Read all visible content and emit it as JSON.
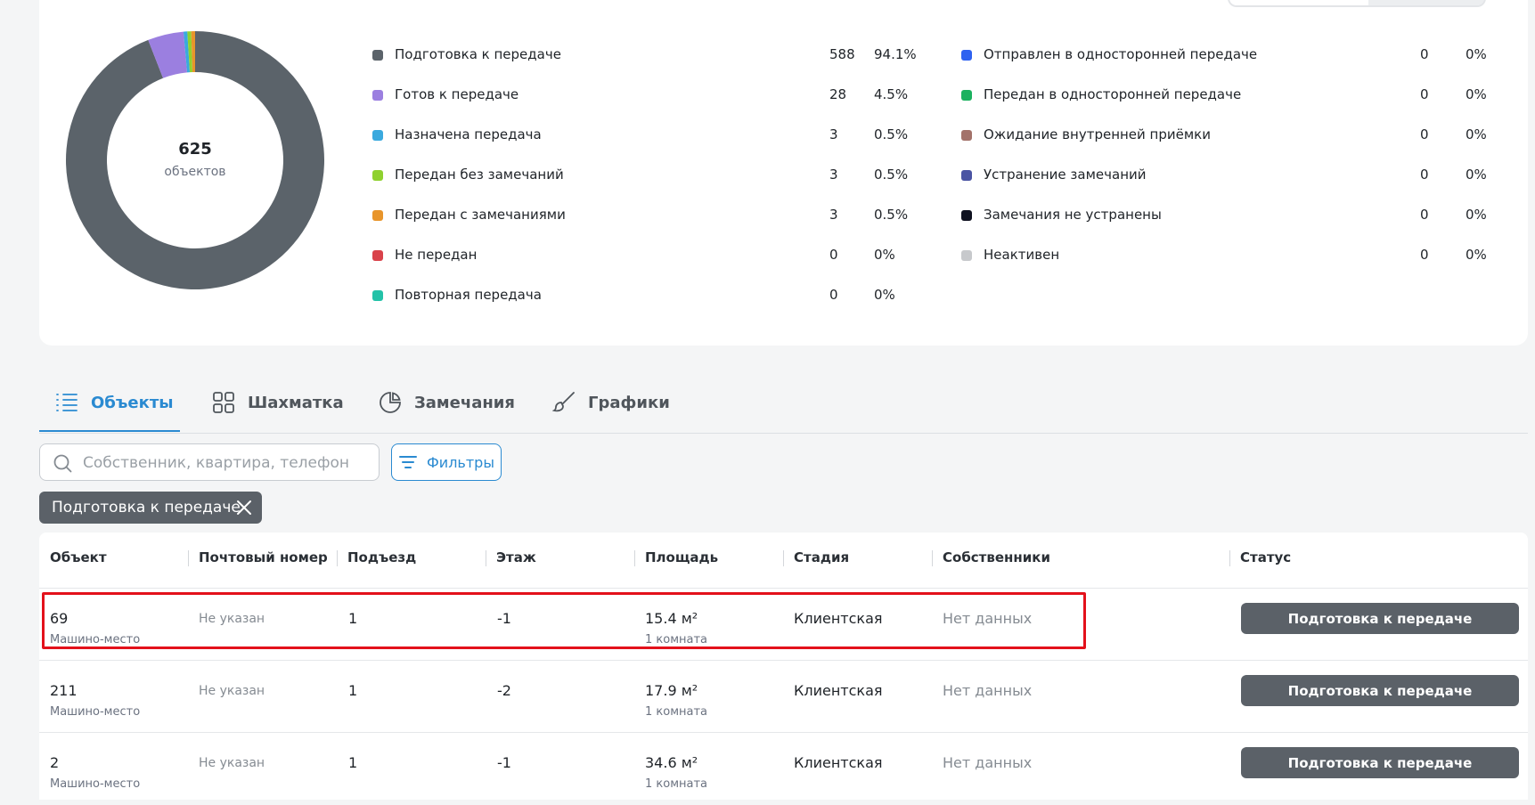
{
  "donut": {
    "count": "625",
    "unit": "объектов",
    "segments": [
      {
        "value": 588,
        "color": "#5b636a"
      },
      {
        "value": 28,
        "color": "#9b7fe0"
      },
      {
        "value": 3,
        "color": "#3aa9de"
      },
      {
        "value": 3,
        "color": "#8fd12f"
      },
      {
        "value": 3,
        "color": "#e8952b"
      }
    ]
  },
  "legend_left": [
    {
      "label": "Подготовка к передаче",
      "count": "588",
      "pct": "94.1%",
      "color": "#5b636a"
    },
    {
      "label": "Готов к передаче",
      "count": "28",
      "pct": "4.5%",
      "color": "#9b7fe0"
    },
    {
      "label": "Назначена передача",
      "count": "3",
      "pct": "0.5%",
      "color": "#3aa9de"
    },
    {
      "label": "Передан без замечаний",
      "count": "3",
      "pct": "0.5%",
      "color": "#8fd12f"
    },
    {
      "label": "Передан с замечаниями",
      "count": "3",
      "pct": "0.5%",
      "color": "#e8952b"
    },
    {
      "label": "Не передан",
      "count": "0",
      "pct": "0%",
      "color": "#d9424a"
    },
    {
      "label": "Повторная передача",
      "count": "0",
      "pct": "0%",
      "color": "#23c2a8"
    }
  ],
  "legend_right": [
    {
      "label": "Отправлен в односторонней передаче",
      "count": "0",
      "pct": "0%",
      "color": "#2f62f0"
    },
    {
      "label": "Передан в односторонней передаче",
      "count": "0",
      "pct": "0%",
      "color": "#1bb15f"
    },
    {
      "label": "Ожидание внутренней приёмки",
      "count": "0",
      "pct": "0%",
      "color": "#a3726a"
    },
    {
      "label": "Устранение замечаний",
      "count": "0",
      "pct": "0%",
      "color": "#4a54a3"
    },
    {
      "label": "Замечания не устранены",
      "count": "0",
      "pct": "0%",
      "color": "#0f1220"
    },
    {
      "label": "Неактивен",
      "count": "0",
      "pct": "0%",
      "color": "#c7c9cc"
    }
  ],
  "tabs": [
    {
      "label": "Объекты",
      "icon": "list-icon"
    },
    {
      "label": "Шахматка",
      "icon": "grid-icon"
    },
    {
      "label": "Замечания",
      "icon": "pie-chart-icon"
    },
    {
      "label": "Графики",
      "icon": "brush-icon"
    }
  ],
  "search": {
    "placeholder": "Собственник, квартира, телефон",
    "value": ""
  },
  "filter_label": "Фильтры",
  "chip_label": "Подготовка к передаче",
  "table": {
    "headers": [
      "Объект",
      "Почтовый номер",
      "Подъезд",
      "Этаж",
      "Площадь",
      "Стадия",
      "Собственники",
      "Статус"
    ],
    "rows": [
      {
        "object": "69",
        "object_type": "Машино-место",
        "postal": "Не указан",
        "entrance": "1",
        "floor": "-1",
        "area": "15.4 м²",
        "rooms": "1 комната",
        "stage": "Клиентская",
        "owners": "Нет данных",
        "status": "Подготовка к передаче"
      },
      {
        "object": "211",
        "object_type": "Машино-место",
        "postal": "Не указан",
        "entrance": "1",
        "floor": "-2",
        "area": "17.9 м²",
        "rooms": "1 комната",
        "stage": "Клиентская",
        "owners": "Нет данных",
        "status": "Подготовка к передаче"
      },
      {
        "object": "2",
        "object_type": "Машино-место",
        "postal": "Не указан",
        "entrance": "1",
        "floor": "-1",
        "area": "34.6 м²",
        "rooms": "1 комната",
        "stage": "Клиентская",
        "owners": "Нет данных",
        "status": "Подготовка к передаче"
      }
    ]
  }
}
